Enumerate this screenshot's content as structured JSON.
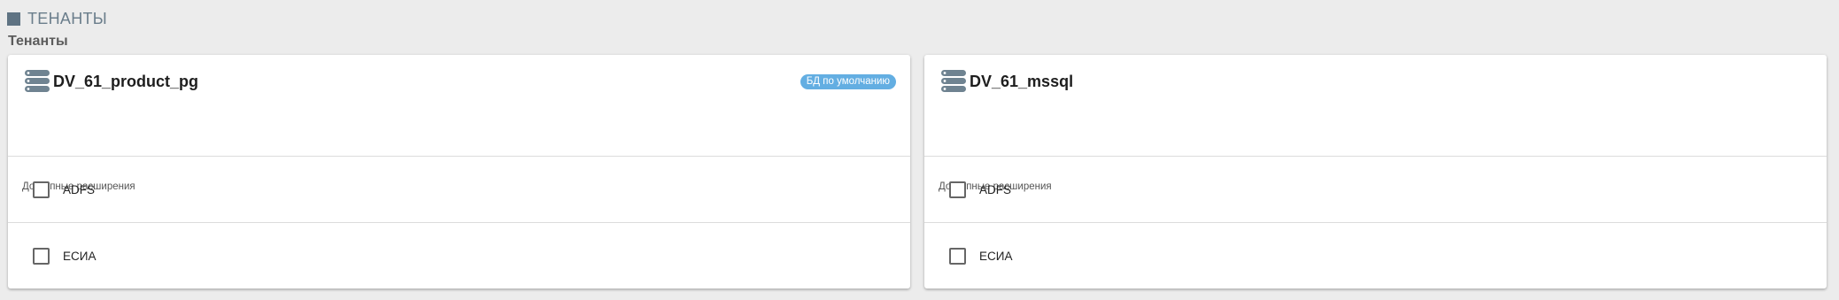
{
  "page": {
    "section_title": "ТЕНАНТЫ",
    "subtitle": "Тенанты"
  },
  "tenants": [
    {
      "name": "DV_61_product_pg",
      "badge": "БД по умолчанию",
      "extensions_label": "Доступные расширения",
      "extensions": [
        {
          "label": "ADFS",
          "checked": false
        },
        {
          "label": "ЕСИА",
          "checked": false
        }
      ]
    },
    {
      "name": "DV_61_mssql",
      "extensions_label": "Доступные расширения",
      "extensions": [
        {
          "label": "ADFS",
          "checked": false
        },
        {
          "label": "ЕСИА",
          "checked": false
        }
      ]
    }
  ],
  "icons": {
    "section": "square-icon",
    "tenant": "database-server-icon",
    "checkbox": "checkbox-icon"
  },
  "colors": {
    "background": "#ececec",
    "section_accent": "#5f7383",
    "badge": "#63aee2",
    "icon": "#6f8391"
  }
}
